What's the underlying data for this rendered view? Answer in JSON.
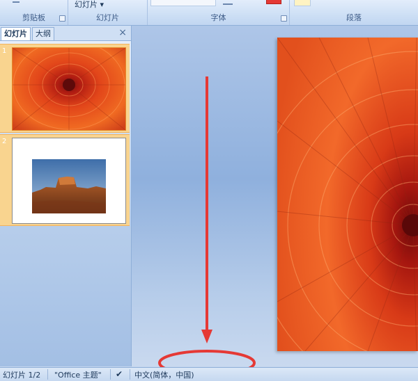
{
  "ribbon": {
    "groups": [
      {
        "label": "剪贴板"
      },
      {
        "label": "幻灯片"
      },
      {
        "label": "字体"
      },
      {
        "label": "段落"
      }
    ],
    "slide_dropdown_label": "幻灯片"
  },
  "panel": {
    "tabs": [
      {
        "label": "幻灯片"
      },
      {
        "label": "大纲"
      }
    ],
    "close_glyph": "×",
    "slides": [
      {
        "number": "1"
      },
      {
        "number": "2"
      }
    ]
  },
  "statusbar": {
    "slide_counter": "幻灯片 1/2",
    "theme": "\"Office 主题\"",
    "language": "中文(简体，中国)"
  },
  "colors": {
    "accent_red": "#e53935",
    "slide_selected": "#f9d48f"
  }
}
